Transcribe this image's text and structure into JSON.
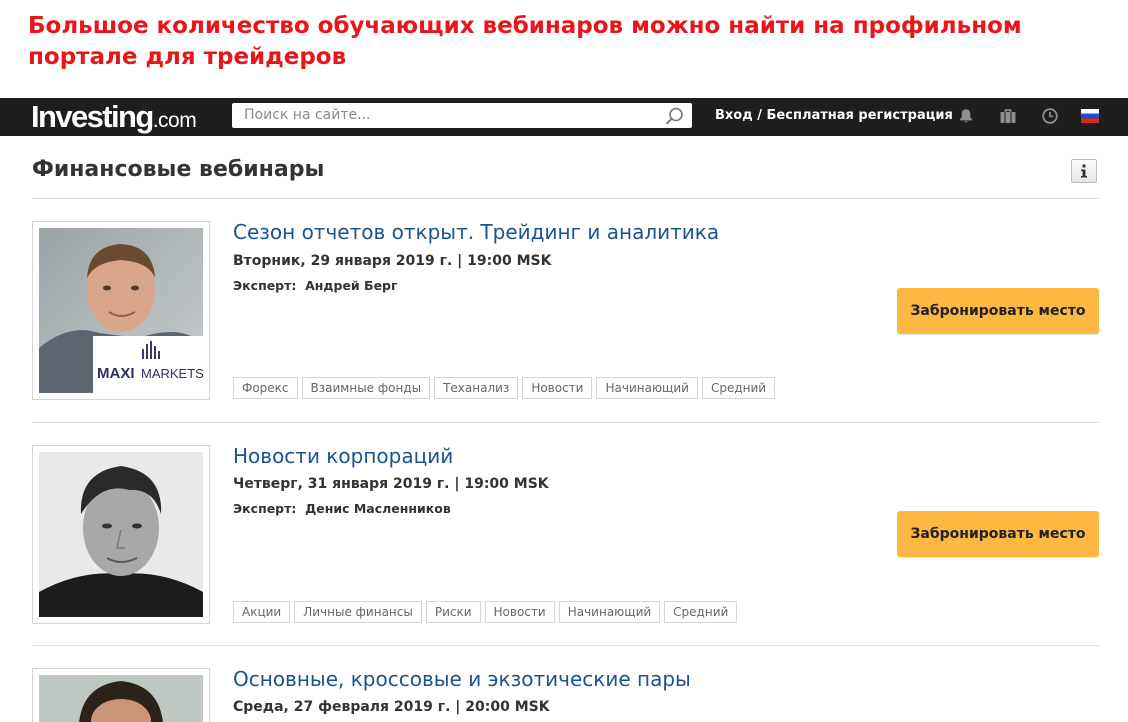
{
  "caption": "Большое количество обучающих вебинаров можно найти на профильном портале для трейдеров",
  "header": {
    "logo_main": "Investing",
    "logo_suffix": ".com",
    "search_placeholder": "Поиск на сайте...",
    "auth_text": "Вход / Бесплатная регистрация"
  },
  "page": {
    "title": "Финансовые вебинары"
  },
  "webinars": [
    {
      "title": "Сезон отчетов открыт. Трейдинг и аналитика",
      "date": "Вторник, 29 января 2019 г. | 19:00 MSK",
      "expert_label": "Эксперт:",
      "expert_name": "Андрей Берг",
      "button": "Забронировать место",
      "sponsor_logo_a": "MAXI",
      "sponsor_logo_b": "MARKETS",
      "tags": [
        "Форекс",
        "Взаимные фонды",
        "Теханализ",
        "Новости",
        "Начинающий",
        "Средний"
      ]
    },
    {
      "title": "Новости корпораций",
      "date": "Четверг, 31 января 2019 г. | 19:00 MSK",
      "expert_label": "Эксперт:",
      "expert_name": "Денис Масленников",
      "button": "Забронировать место",
      "tags": [
        "Акции",
        "Личные финансы",
        "Риски",
        "Новости",
        "Начинающий",
        "Средний"
      ]
    },
    {
      "title": "Основные, кроссовые и экзотические пары",
      "date": "Среда, 27 февраля 2019 г. | 20:00 MSK"
    }
  ],
  "icons": {
    "search": "search-icon",
    "bell": "bell-icon",
    "portfolio": "briefcase-icon",
    "clock": "clock-icon",
    "flag": "russia-flag-icon",
    "info": "info-icon"
  },
  "colors": {
    "caption": "#e8161b",
    "topbar": "#1e1e1e",
    "link": "#1a5490",
    "button": "#fdb843"
  }
}
